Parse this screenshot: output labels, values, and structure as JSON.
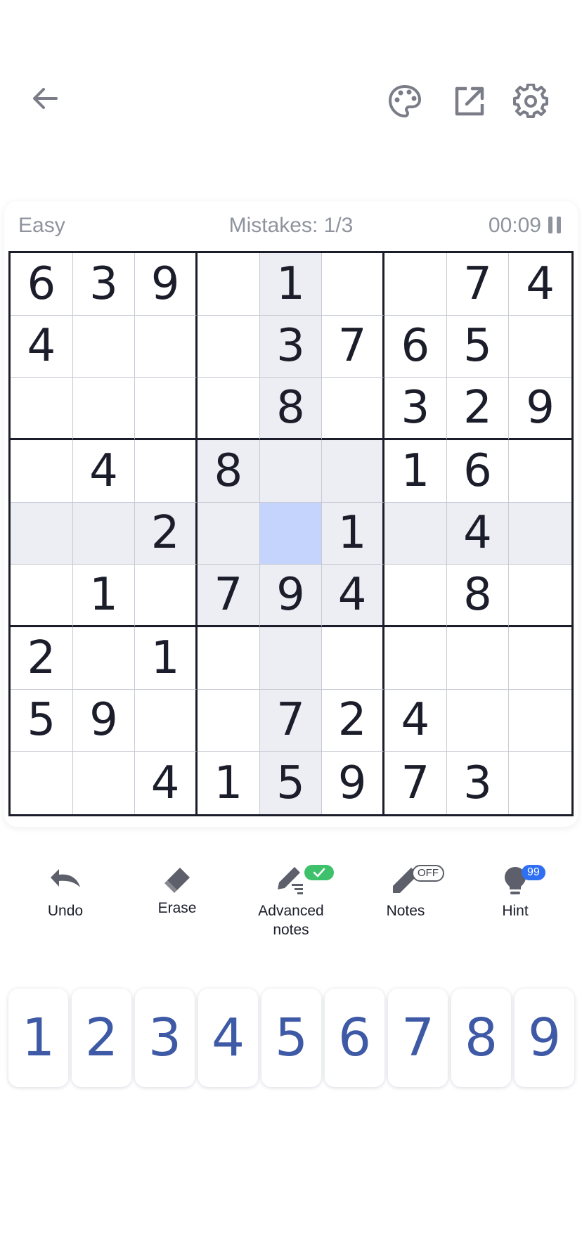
{
  "header": {
    "back_icon": "arrow-left-icon",
    "theme_icon": "palette-icon",
    "export_icon": "external-link-icon",
    "settings_icon": "gear-icon"
  },
  "status": {
    "difficulty": "Easy",
    "mistakes": "Mistakes: 1/3",
    "timer": "00:09"
  },
  "board": {
    "selected": [
      4,
      4
    ],
    "rows": [
      [
        "6",
        "3",
        "9",
        "",
        "1",
        "",
        "",
        "7",
        "4"
      ],
      [
        "4",
        "",
        "",
        "",
        "3",
        "7",
        "6",
        "5",
        ""
      ],
      [
        "",
        "",
        "",
        "",
        "8",
        "",
        "3",
        "2",
        "9"
      ],
      [
        "",
        "4",
        "",
        "8",
        "",
        "",
        "1",
        "6",
        ""
      ],
      [
        "",
        "",
        "2",
        "",
        "",
        "1",
        "",
        "4",
        ""
      ],
      [
        "",
        "1",
        "",
        "7",
        "9",
        "4",
        "",
        "8",
        ""
      ],
      [
        "2",
        "",
        "1",
        "",
        "",
        "",
        "",
        "",
        ""
      ],
      [
        "5",
        "9",
        "",
        "",
        "7",
        "2",
        "4",
        "",
        ""
      ],
      [
        "",
        "",
        "4",
        "1",
        "5",
        "9",
        "7",
        "3",
        ""
      ]
    ]
  },
  "tools": {
    "undo": "Undo",
    "erase": "Erase",
    "advanced_notes_line1": "Advanced",
    "advanced_notes_line2": "notes",
    "notes": "Notes",
    "notes_badge": "OFF",
    "hint": "Hint",
    "hint_badge": "99"
  },
  "numpad": [
    "1",
    "2",
    "3",
    "4",
    "5",
    "6",
    "7",
    "8",
    "9"
  ],
  "colors": {
    "accent": "#3e5aa6",
    "selected_cell": "#c4d4fd",
    "highlight_cell": "#eceef3",
    "hint_badge": "#2f6ff2",
    "check_badge": "#3ec16a"
  }
}
